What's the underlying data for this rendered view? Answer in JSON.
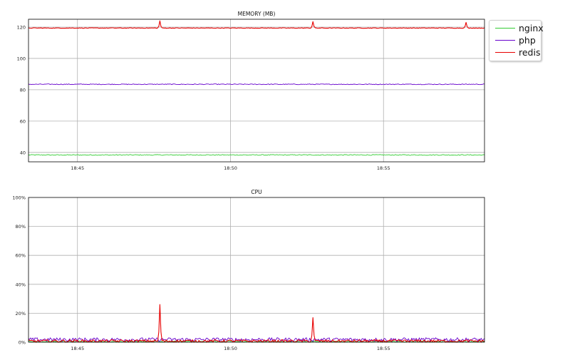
{
  "colors": {
    "nginx": "#33cc33",
    "php": "#6600cc",
    "redis": "#e80000"
  },
  "chart_data": [
    {
      "type": "line",
      "title": "MEMORY (MB)",
      "xlabel": "",
      "ylabel": "",
      "x_ticks": [
        "18:45",
        "18:50",
        "18:55"
      ],
      "x_range_minutes": [
        "18:43.4",
        "18:58.3"
      ],
      "ylim": [
        34,
        125
      ],
      "y_ticks": [
        "40",
        "60",
        "80",
        "100",
        "120"
      ],
      "grid": true,
      "legend": "outside-top-right",
      "series": [
        {
          "name": "nginx",
          "baseline": 38.4,
          "spikes": []
        },
        {
          "name": "php",
          "baseline": 83.5,
          "spikes": []
        },
        {
          "name": "redis",
          "baseline": 119.4,
          "spikes": [
            {
              "time": "18:47.7",
              "value": 124
            },
            {
              "time": "18:52.7",
              "value": 123.5
            },
            {
              "time": "18:57.7",
              "value": 123
            }
          ]
        }
      ]
    },
    {
      "type": "line",
      "title": "CPU",
      "xlabel": "",
      "ylabel": "",
      "x_ticks": [
        "18:45",
        "18:50",
        "18:55"
      ],
      "x_range_minutes": [
        "18:43.4",
        "18:58.3"
      ],
      "ylim": [
        0,
        100
      ],
      "y_ticks": [
        "0%",
        "20%",
        "40%",
        "60%",
        "80%",
        "100%"
      ],
      "grid": true,
      "series": [
        {
          "name": "nginx",
          "baseline": 0.4,
          "spikes": []
        },
        {
          "name": "php",
          "baseline": 1.8,
          "spikes": []
        },
        {
          "name": "redis",
          "baseline": 0.8,
          "spikes": [
            {
              "time": "18:47.7",
              "value": 26
            },
            {
              "time": "18:52.7",
              "value": 17
            }
          ]
        }
      ]
    }
  ],
  "legend": {
    "items": [
      "nginx",
      "php",
      "redis"
    ]
  }
}
